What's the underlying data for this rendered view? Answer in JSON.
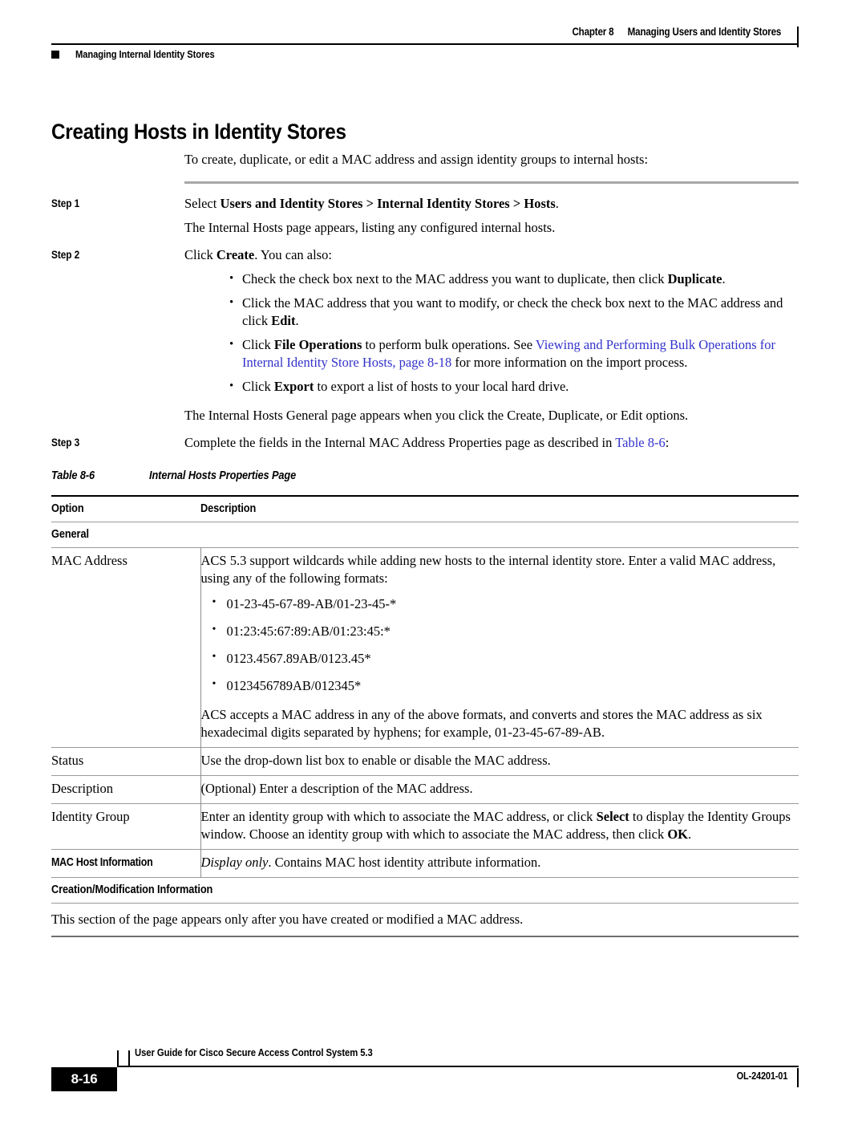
{
  "header": {
    "chapter_number": "Chapter 8",
    "chapter_title": "Managing Users and Identity Stores",
    "section_title": "Managing Internal Identity Stores"
  },
  "page_title": "Creating Hosts in Identity Stores",
  "intro": "To create, duplicate, or edit a MAC address and assign identity groups to internal hosts:",
  "steps": [
    {
      "label": "Step 1",
      "text_parts": [
        {
          "text": "Select ",
          "style": "normal"
        },
        {
          "text": "Users and Identity Stores > Internal Identity Stores > Hosts",
          "style": "bold"
        },
        {
          "text": ".",
          "style": "normal"
        }
      ],
      "follow_up": "The Internal Hosts page appears, listing any configured internal hosts."
    },
    {
      "label": "Step 2",
      "text_parts": [
        {
          "text": "Click ",
          "style": "normal"
        },
        {
          "text": "Create",
          "style": "bold"
        },
        {
          "text": ". You can also:",
          "style": "normal"
        }
      ],
      "bullets": [
        [
          {
            "text": "Check the check box next to the MAC address you want to duplicate, then click ",
            "style": "normal"
          },
          {
            "text": "Duplicate",
            "style": "bold"
          },
          {
            "text": ".",
            "style": "normal"
          }
        ],
        [
          {
            "text": "Click the MAC address that you want to modify, or check the check box next to the MAC address and click ",
            "style": "normal"
          },
          {
            "text": "Edit",
            "style": "bold"
          },
          {
            "text": ".",
            "style": "normal"
          }
        ],
        [
          {
            "text": "Click ",
            "style": "normal"
          },
          {
            "text": "File Operations",
            "style": "bold"
          },
          {
            "text": " to perform bulk operations. See ",
            "style": "normal"
          },
          {
            "text": "Viewing and Performing Bulk Operations for Internal Identity Store Hosts, page 8-18",
            "style": "link"
          },
          {
            "text": " for more information on the import process.",
            "style": "normal"
          }
        ],
        [
          {
            "text": "Click ",
            "style": "normal"
          },
          {
            "text": "Export",
            "style": "bold"
          },
          {
            "text": " to export a list of hosts to your local hard drive.",
            "style": "normal"
          }
        ]
      ],
      "follow_up": "The Internal Hosts General page appears when you click the Create, Duplicate, or Edit options."
    },
    {
      "label": "Step 3",
      "text_parts": [
        {
          "text": "Complete the fields in the Internal MAC Address Properties page as described in ",
          "style": "normal"
        },
        {
          "text": "Table 8-6",
          "style": "link"
        },
        {
          "text": ":",
          "style": "normal"
        }
      ]
    }
  ],
  "table": {
    "caption_number": "Table 8-6",
    "caption_title": "Internal Hosts Properties Page",
    "columns": [
      "Option",
      "Description"
    ],
    "rows": [
      {
        "kind": "section",
        "label": "General"
      },
      {
        "kind": "data",
        "option": "MAC Address",
        "description_lead": "ACS 5.3 support wildcards while adding new hosts to the internal identity store. Enter a valid MAC address, using any of the following formats:",
        "description_bullets": [
          "01-23-45-67-89-AB/01-23-45-*",
          "01:23:45:67:89:AB/01:23:45:*",
          "0123.4567.89AB/0123.45*",
          "0123456789AB/012345*"
        ],
        "description_tail": "ACS accepts a MAC address in any of the above formats, and converts and stores the MAC address as six hexadecimal digits separated by hyphens; for example, 01-23-45-67-89-AB."
      },
      {
        "kind": "data",
        "option": "Status",
        "description_lead": "Use the drop-down list box to enable or disable the MAC address."
      },
      {
        "kind": "data",
        "option": "Description",
        "description_lead": "(Optional) Enter a description of the MAC address."
      },
      {
        "kind": "data",
        "option": "Identity Group",
        "description_parts": [
          {
            "text": "Enter an identity group with which to associate the MAC address, or click ",
            "style": "normal"
          },
          {
            "text": "Select",
            "style": "bold"
          },
          {
            "text": " to display the Identity Groups window. Choose an identity group with which to associate the MAC address, then click ",
            "style": "normal"
          },
          {
            "text": "OK",
            "style": "bold"
          },
          {
            "text": ".",
            "style": "normal"
          }
        ]
      },
      {
        "kind": "data-bold-option",
        "option": "MAC Host Information",
        "description_parts": [
          {
            "text": "Display only",
            "style": "italic"
          },
          {
            "text": ". Contains MAC host identity attribute information.",
            "style": "normal"
          }
        ]
      },
      {
        "kind": "section",
        "label": "Creation/Modification Information"
      },
      {
        "kind": "fullwidth",
        "text": "This section of the page appears only after you have created or modified a MAC address."
      }
    ]
  },
  "footer": {
    "guide_title": "User Guide for Cisco Secure Access Control System 5.3",
    "page_number": "8-16",
    "doc_id": "OL-24201-01"
  },
  "colors": {
    "link": "#3333cc",
    "rule_gray": "#9a9a9a",
    "rule_black": "#000000"
  }
}
